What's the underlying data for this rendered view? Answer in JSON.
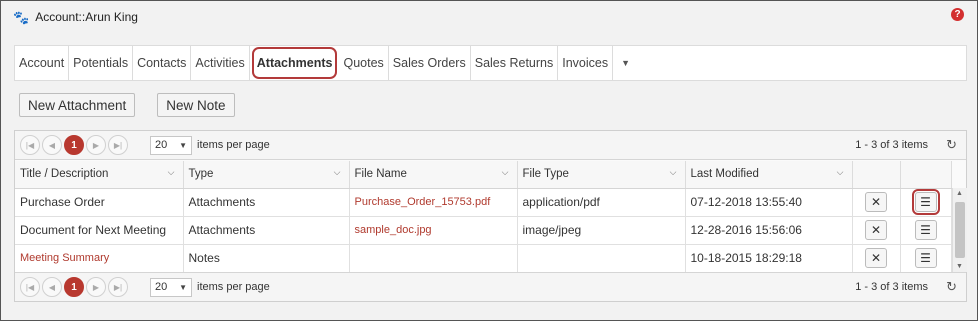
{
  "header": {
    "title": "Account::Arun King",
    "help_icon": "?"
  },
  "tabs": [
    {
      "label": "Account"
    },
    {
      "label": "Potentials"
    },
    {
      "label": "Contacts"
    },
    {
      "label": "Activities"
    },
    {
      "label": "Attachments",
      "active": true
    },
    {
      "label": "Quotes"
    },
    {
      "label": "Sales Orders"
    },
    {
      "label": "Sales Returns"
    },
    {
      "label": "Invoices"
    }
  ],
  "toolbar": {
    "new_attachment": "New Attachment",
    "new_note": "New Note"
  },
  "pager": {
    "current_page": "1",
    "page_size": "20",
    "items_per_page_label": "items per page",
    "count": "1 - 3 of 3 items"
  },
  "columns": {
    "title": "Title / Description",
    "type": "Type",
    "file_name": "File Name",
    "file_type": "File Type",
    "last_modified": "Last Modified"
  },
  "rows": [
    {
      "title": "Purchase Order",
      "type": "Attachments",
      "file_name": "Purchase_Order_15753.pdf",
      "file_type": "application/pdf",
      "last_modified": "07-12-2018 13:55:40"
    },
    {
      "title": "Document for Next Meeting",
      "type": "Attachments",
      "file_name": "sample_doc.jpg",
      "file_type": "image/jpeg",
      "last_modified": "12-28-2016 15:56:06"
    },
    {
      "title": "Meeting Summary",
      "type": "Notes",
      "file_name": "",
      "file_type": "",
      "last_modified": "10-18-2015 18:29:18"
    }
  ],
  "colors": {
    "accent": "#b33a3a",
    "link": "#b03a2e"
  }
}
